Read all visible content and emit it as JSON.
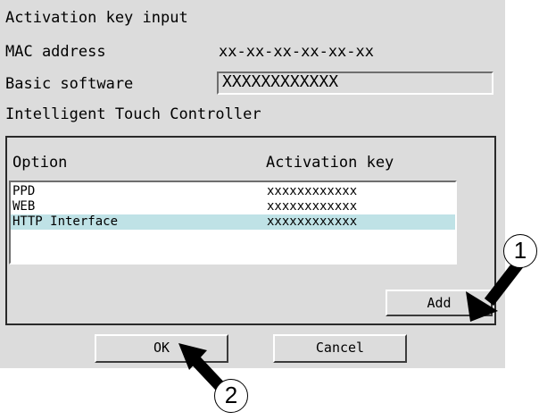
{
  "dialog": {
    "title": "Activation key input",
    "mac_label": "MAC address",
    "mac_value": "xx-xx-xx-xx-xx-xx",
    "basic_label": "Basic software",
    "basic_value": "XXXXXXXXXXXX",
    "itc_label": "Intelligent Touch Controller"
  },
  "options_table": {
    "headers": [
      "Option",
      "Activation key"
    ],
    "rows": [
      {
        "option": "PPD",
        "key": "xxxxxxxxxxxx"
      },
      {
        "option": "WEB",
        "key": "xxxxxxxxxxxx"
      },
      {
        "option": "HTTP Interface",
        "key": "xxxxxxxxxxxx"
      }
    ],
    "selected_row": 2
  },
  "buttons": {
    "add": "Add",
    "ok": "OK",
    "cancel": "Cancel"
  },
  "callouts": {
    "one": "1",
    "two": "2"
  },
  "colors": {
    "dialog_bg": "#dcdcdc",
    "selection": "#bfe2e6"
  }
}
